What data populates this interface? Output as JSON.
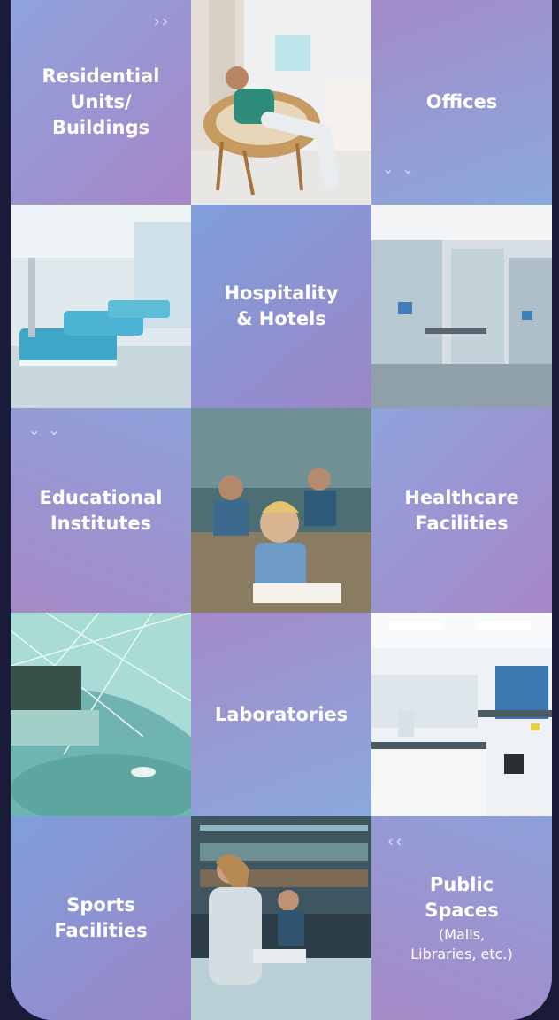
{
  "tiles": {
    "residential": "Residential\nUnits/\nBuildings",
    "offices": "Offices",
    "hospitality": "Hospitality\n& Hotels",
    "educational": "Educational\nInstitutes",
    "healthcare": "Healthcare\nFacilities",
    "laboratories": "Laboratories",
    "sports": "Sports\nFacilities",
    "public_title": "Public\nSpaces",
    "public_sub": "(Malls,\nLibraries, etc.)"
  },
  "chevrons": {
    "right": "››",
    "down": "⌄\n⌄",
    "left": "‹‹"
  },
  "colors": {
    "page_bg": "#1a1b38",
    "tile_blue": "#8fa3dd",
    "tile_purple": "#a786c7"
  }
}
